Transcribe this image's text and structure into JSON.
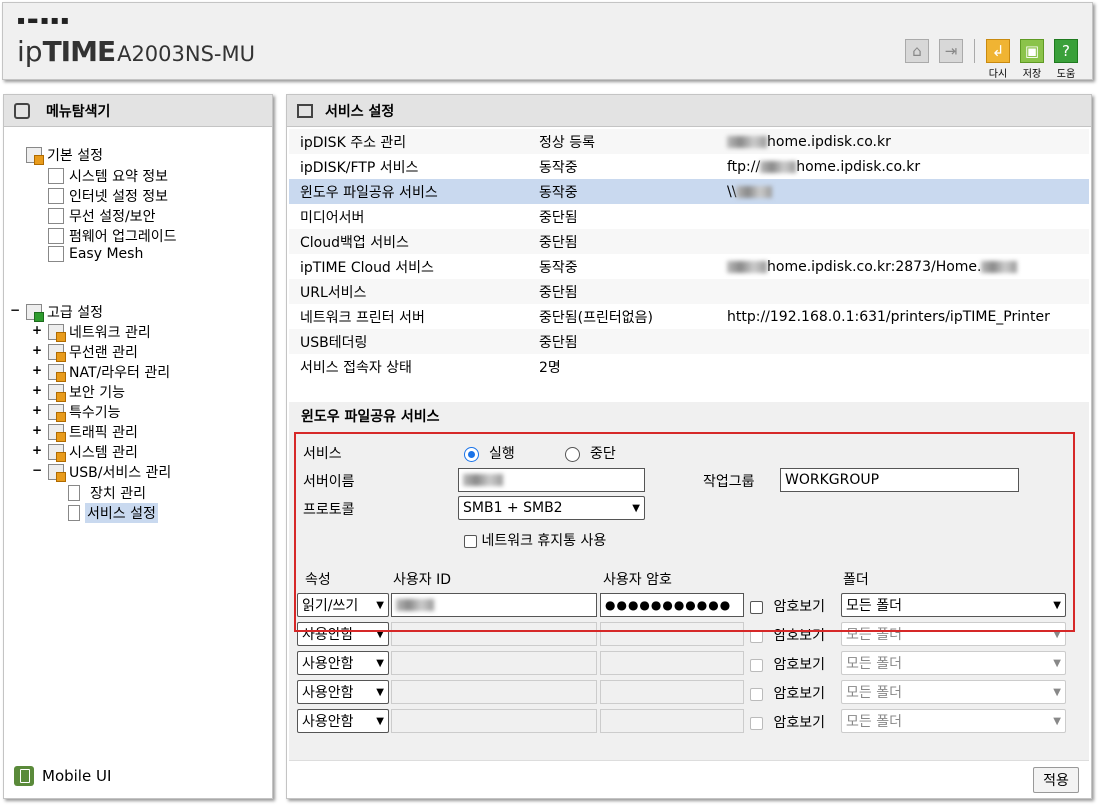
{
  "header": {
    "logo_dots": "▪▬▪▪▪",
    "logo_ip": "ip",
    "logo_time": "TIME",
    "model": "A2003NS-MU",
    "buttons": [
      {
        "icon": "home-icon",
        "label": "",
        "color": "#d8d8d8"
      },
      {
        "icon": "logout-icon",
        "label": "",
        "color": "#d8d8d8"
      },
      {
        "icon": "undo-icon",
        "label": "다시",
        "color": "#f0b433"
      },
      {
        "icon": "save-icon",
        "label": "저장",
        "color": "#8bc34a"
      },
      {
        "icon": "help-icon",
        "label": "도움",
        "color": "#3aa03a"
      }
    ]
  },
  "sidebar": {
    "title": "메뉴탐색기",
    "basic": {
      "label": "기본 설정",
      "items": [
        "시스템 요약 정보",
        "인터넷 설정 정보",
        "무선 설정/보안",
        "펌웨어 업그레이드",
        "Easy Mesh"
      ]
    },
    "advanced": {
      "label": "고급 설정",
      "items": [
        "네트워크 관리",
        "무선랜 관리",
        "NAT/라우터 관리",
        "보안 기능",
        "특수기능",
        "트래픽 관리",
        "시스템 관리",
        "USB/서비스 관리"
      ],
      "usb_children": [
        "장치 관리",
        "서비스 설정"
      ]
    },
    "mobile": "Mobile UI"
  },
  "main": {
    "title": "서비스 설정",
    "services": [
      {
        "name": "ipDISK 주소 관리",
        "status": "정상 등록",
        "prefix": "",
        "info": "home.ipdisk.co.kr",
        "blur": true
      },
      {
        "name": "ipDISK/FTP 서비스",
        "status": "동작중",
        "prefix": "ftp://",
        "info": "home.ipdisk.co.kr",
        "blur": true
      },
      {
        "name": "윈도우 파일공유 서비스",
        "status": "동작중",
        "prefix": "\\\\",
        "info": "",
        "blur": true
      },
      {
        "name": "미디어서버",
        "status": "중단됨",
        "prefix": "",
        "info": "",
        "blur": false
      },
      {
        "name": "Cloud백업 서비스",
        "status": "중단됨",
        "prefix": "",
        "info": "",
        "blur": false
      },
      {
        "name": "ipTIME Cloud 서비스",
        "status": "동작중",
        "prefix": "",
        "info": "home.ipdisk.co.kr:2873/Home.",
        "blur": true
      },
      {
        "name": "URL서비스",
        "status": "중단됨",
        "prefix": "",
        "info": "",
        "blur": false
      },
      {
        "name": "네트워크 프린터 서버",
        "status": "중단됨(프린터없음)",
        "prefix": "",
        "info": "http://192.168.0.1:631/printers/ipTIME_Printer",
        "blur": false
      },
      {
        "name": "USB테더링",
        "status": "중단됨",
        "prefix": "",
        "info": "",
        "blur": false
      },
      {
        "name": "서비스 접속자 상태",
        "status": "2명",
        "prefix": "",
        "info": "",
        "blur": false
      }
    ],
    "section_title": "윈도우 파일공유 서비스",
    "form": {
      "service_label": "서비스",
      "run_label": "실행",
      "stop_label": "중단",
      "server_name_label": "서버이름",
      "workgroup_label": "작업그룹",
      "workgroup_value": "WORKGROUP",
      "protocol_label": "프로토콜",
      "protocol_value": "SMB1 + SMB2",
      "recycle_label": "네트워크 휴지통 사용",
      "col_attr": "속성",
      "col_user": "사용자 ID",
      "col_pw": "사용자 암호",
      "col_folder": "폴더",
      "show_pw_label": "암호보기",
      "users": [
        {
          "attr": "읽기/쓰기",
          "pw": "●●●●●●●●●●●",
          "folder": "모든 폴더",
          "active": true
        },
        {
          "attr": "사용안함",
          "pw": "",
          "folder": "모든 폴더",
          "active": false
        },
        {
          "attr": "사용안함",
          "pw": "",
          "folder": "모든 폴더",
          "active": false
        },
        {
          "attr": "사용안함",
          "pw": "",
          "folder": "모든 폴더",
          "active": false
        },
        {
          "attr": "사용안함",
          "pw": "",
          "folder": "모든 폴더",
          "active": false
        }
      ]
    },
    "apply_label": "적용"
  },
  "colors": {
    "highlight": "#c9d9ef",
    "redbox": "#d62828"
  }
}
